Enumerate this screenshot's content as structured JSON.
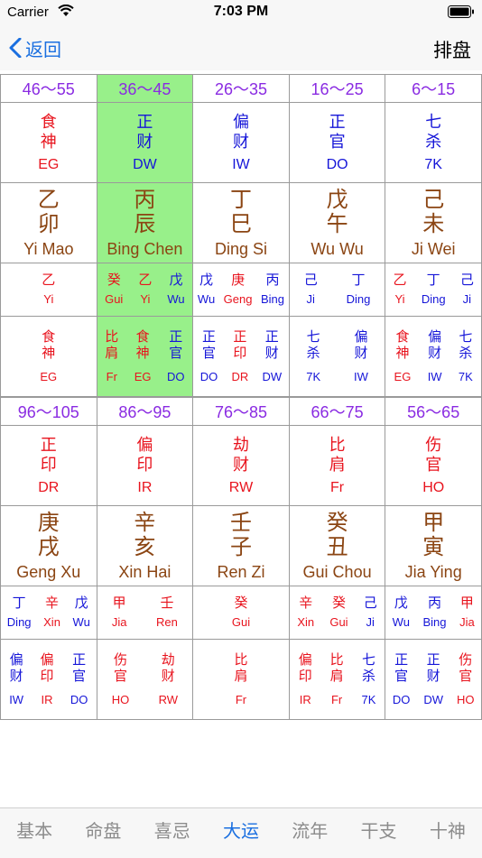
{
  "status": {
    "carrier": "Carrier",
    "time": "7:03 PM"
  },
  "nav": {
    "back_label": "返回",
    "title": "排盘"
  },
  "colors": {
    "red": "#e8141e",
    "blue": "#1515d8",
    "brown": "#8b4513",
    "purple": "#8a2be2",
    "highlight": "#98f08a",
    "accent": "#1a6fe0"
  },
  "grid1": [
    {
      "age": "46～55",
      "star": [
        "食",
        "神"
      ],
      "star_code": "EG",
      "star_color": "red",
      "stem": "乙",
      "branch": "卯",
      "pinyin": "Yi Mao",
      "hidden": [
        {
          "c": "乙",
          "p": "Yi",
          "col": "red"
        }
      ],
      "gods": [
        {
          "c": [
            "食",
            "神"
          ],
          "p": "EG",
          "col": "red"
        }
      ]
    },
    {
      "age": "36～45",
      "highlight": true,
      "star": [
        "正",
        "财"
      ],
      "star_code": "DW",
      "star_color": "blue",
      "stem": "丙",
      "branch": "辰",
      "pinyin": "Bing Chen",
      "hidden": [
        {
          "c": "癸",
          "p": "Gui",
          "col": "red"
        },
        {
          "c": "乙",
          "p": "Yi",
          "col": "red"
        },
        {
          "c": "戊",
          "p": "Wu",
          "col": "blue"
        }
      ],
      "gods": [
        {
          "c": [
            "比",
            "肩"
          ],
          "p": "Fr",
          "col": "red"
        },
        {
          "c": [
            "食",
            "神"
          ],
          "p": "EG",
          "col": "red"
        },
        {
          "c": [
            "正",
            "官"
          ],
          "p": "DO",
          "col": "blue"
        }
      ]
    },
    {
      "age": "26～35",
      "star": [
        "偏",
        "财"
      ],
      "star_code": "IW",
      "star_color": "blue",
      "stem": "丁",
      "branch": "巳",
      "pinyin": "Ding Si",
      "hidden": [
        {
          "c": "戊",
          "p": "Wu",
          "col": "blue"
        },
        {
          "c": "庚",
          "p": "Geng",
          "col": "red"
        },
        {
          "c": "丙",
          "p": "Bing",
          "col": "blue"
        }
      ],
      "gods": [
        {
          "c": [
            "正",
            "官"
          ],
          "p": "DO",
          "col": "blue"
        },
        {
          "c": [
            "正",
            "印"
          ],
          "p": "DR",
          "col": "red"
        },
        {
          "c": [
            "正",
            "财"
          ],
          "p": "DW",
          "col": "blue"
        }
      ]
    },
    {
      "age": "16～25",
      "star": [
        "正",
        "官"
      ],
      "star_code": "DO",
      "star_color": "blue",
      "stem": "戊",
      "branch": "午",
      "pinyin": "Wu Wu",
      "hidden": [
        {
          "c": "己",
          "p": "Ji",
          "col": "blue"
        },
        {
          "c": "丁",
          "p": "Ding",
          "col": "blue"
        }
      ],
      "gods": [
        {
          "c": [
            "七",
            "杀"
          ],
          "p": "7K",
          "col": "blue"
        },
        {
          "c": [
            "偏",
            "财"
          ],
          "p": "IW",
          "col": "blue"
        }
      ]
    },
    {
      "age": "6～15",
      "star": [
        "七",
        "杀"
      ],
      "star_code": "7K",
      "star_color": "blue",
      "stem": "己",
      "branch": "未",
      "pinyin": "Ji Wei",
      "hidden": [
        {
          "c": "乙",
          "p": "Yi",
          "col": "red"
        },
        {
          "c": "丁",
          "p": "Ding",
          "col": "blue"
        },
        {
          "c": "己",
          "p": "Ji",
          "col": "blue"
        }
      ],
      "gods": [
        {
          "c": [
            "食",
            "神"
          ],
          "p": "EG",
          "col": "red"
        },
        {
          "c": [
            "偏",
            "财"
          ],
          "p": "IW",
          "col": "blue"
        },
        {
          "c": [
            "七",
            "杀"
          ],
          "p": "7K",
          "col": "blue"
        }
      ]
    }
  ],
  "grid2": [
    {
      "age": "96～105",
      "star": [
        "正",
        "印"
      ],
      "star_code": "DR",
      "star_color": "red",
      "stem": "庚",
      "branch": "戌",
      "pinyin": "Geng Xu",
      "hidden": [
        {
          "c": "丁",
          "p": "Ding",
          "col": "blue"
        },
        {
          "c": "辛",
          "p": "Xin",
          "col": "red"
        },
        {
          "c": "戊",
          "p": "Wu",
          "col": "blue"
        }
      ],
      "gods": [
        {
          "c": [
            "偏",
            "财"
          ],
          "p": "IW",
          "col": "blue"
        },
        {
          "c": [
            "偏",
            "印"
          ],
          "p": "IR",
          "col": "red"
        },
        {
          "c": [
            "正",
            "官"
          ],
          "p": "DO",
          "col": "blue"
        }
      ]
    },
    {
      "age": "86～95",
      "star": [
        "偏",
        "印"
      ],
      "star_code": "IR",
      "star_color": "red",
      "stem": "辛",
      "branch": "亥",
      "pinyin": "Xin Hai",
      "hidden": [
        {
          "c": "甲",
          "p": "Jia",
          "col": "red"
        },
        {
          "c": "壬",
          "p": "Ren",
          "col": "red"
        }
      ],
      "gods": [
        {
          "c": [
            "伤",
            "官"
          ],
          "p": "HO",
          "col": "red"
        },
        {
          "c": [
            "劫",
            "财"
          ],
          "p": "RW",
          "col": "red"
        }
      ]
    },
    {
      "age": "76～85",
      "star": [
        "劫",
        "财"
      ],
      "star_code": "RW",
      "star_color": "red",
      "stem": "壬",
      "branch": "子",
      "pinyin": "Ren Zi",
      "hidden": [
        {
          "c": "癸",
          "p": "Gui",
          "col": "red"
        }
      ],
      "gods": [
        {
          "c": [
            "比",
            "肩"
          ],
          "p": "Fr",
          "col": "red"
        }
      ]
    },
    {
      "age": "66～75",
      "star": [
        "比",
        "肩"
      ],
      "star_code": "Fr",
      "star_color": "red",
      "stem": "癸",
      "branch": "丑",
      "pinyin": "Gui Chou",
      "hidden": [
        {
          "c": "辛",
          "p": "Xin",
          "col": "red"
        },
        {
          "c": "癸",
          "p": "Gui",
          "col": "red"
        },
        {
          "c": "己",
          "p": "Ji",
          "col": "blue"
        }
      ],
      "gods": [
        {
          "c": [
            "偏",
            "印"
          ],
          "p": "IR",
          "col": "red"
        },
        {
          "c": [
            "比",
            "肩"
          ],
          "p": "Fr",
          "col": "red"
        },
        {
          "c": [
            "七",
            "杀"
          ],
          "p": "7K",
          "col": "blue"
        }
      ]
    },
    {
      "age": "56～65",
      "star": [
        "伤",
        "官"
      ],
      "star_code": "HO",
      "star_color": "red",
      "stem": "甲",
      "branch": "寅",
      "pinyin": "Jia Ying",
      "hidden": [
        {
          "c": "戊",
          "p": "Wu",
          "col": "blue"
        },
        {
          "c": "丙",
          "p": "Bing",
          "col": "blue"
        },
        {
          "c": "甲",
          "p": "Jia",
          "col": "red"
        }
      ],
      "gods": [
        {
          "c": [
            "正",
            "官"
          ],
          "p": "DO",
          "col": "blue"
        },
        {
          "c": [
            "正",
            "财"
          ],
          "p": "DW",
          "col": "blue"
        },
        {
          "c": [
            "伤",
            "官"
          ],
          "p": "HO",
          "col": "red"
        }
      ]
    }
  ],
  "tabs": [
    {
      "label": "基本"
    },
    {
      "label": "命盘"
    },
    {
      "label": "喜忌"
    },
    {
      "label": "大运",
      "active": true
    },
    {
      "label": "流年"
    },
    {
      "label": "干支"
    },
    {
      "label": "十神"
    }
  ]
}
